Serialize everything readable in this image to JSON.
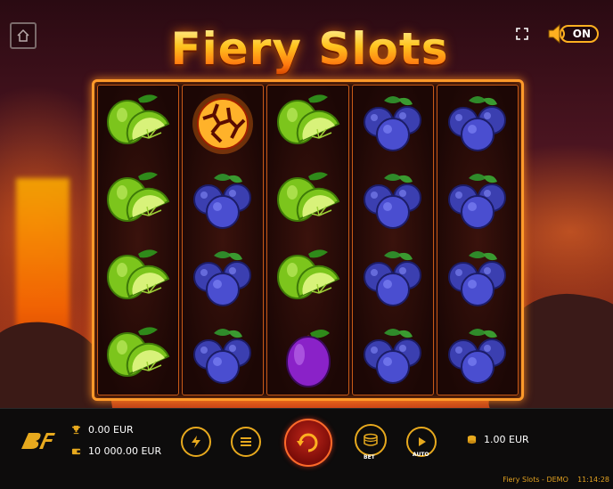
{
  "game": {
    "title": "Fiery Slots"
  },
  "sound": {
    "state": "ON"
  },
  "reels": [
    [
      "lime",
      "fireball",
      "lime",
      "blueberry",
      "blueberry"
    ],
    [
      "lime",
      "blueberry",
      "lime",
      "blueberry",
      "blueberry"
    ],
    [
      "lime",
      "blueberry",
      "lime",
      "blueberry",
      "blueberry"
    ],
    [
      "lime",
      "blueberry",
      "plum",
      "blueberry",
      "blueberry"
    ]
  ],
  "stats": {
    "win": "0.00 EUR",
    "balance": "10 000.00 EUR",
    "bet": "1.00 EUR"
  },
  "controls": {
    "bet_label": "BET",
    "auto_label": "AUTO"
  },
  "footer": {
    "game_mode": "Fiery Slots - DEMO",
    "time": "11:14:28"
  },
  "icons": {
    "home": "home-icon",
    "fullscreen": "fullscreen-icon",
    "sound": "speaker-icon",
    "trophy": "trophy-icon",
    "wallet": "wallet-icon",
    "turbo": "lightning-icon",
    "menu": "menu-icon",
    "spin": "spin-icon",
    "bet": "coin-stack-icon",
    "auto": "autoplay-icon",
    "coin": "coin-icon"
  },
  "colors": {
    "accent": "#e7a91e",
    "frame": "#ff9a2a",
    "spin": "#c0261a"
  }
}
